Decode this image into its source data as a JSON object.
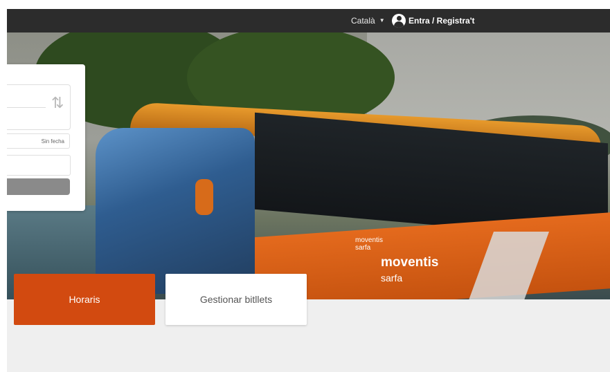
{
  "topbar": {
    "language": "Català",
    "login_label": "Entra / Registra't"
  },
  "hero": {
    "bus_brand": "moventis",
    "bus_sub": "sarfa"
  },
  "search_form": {
    "date_value": "Sin fecha"
  },
  "tiles": {
    "horaris": "Horaris",
    "gestionar": "Gestionar bitllets"
  },
  "colors": {
    "accent": "#d24a10",
    "topbar": "#2c2c2c",
    "page_bg": "#efefef"
  },
  "icons": [
    "caret-down-icon",
    "user-icon",
    "swap-icon"
  ]
}
